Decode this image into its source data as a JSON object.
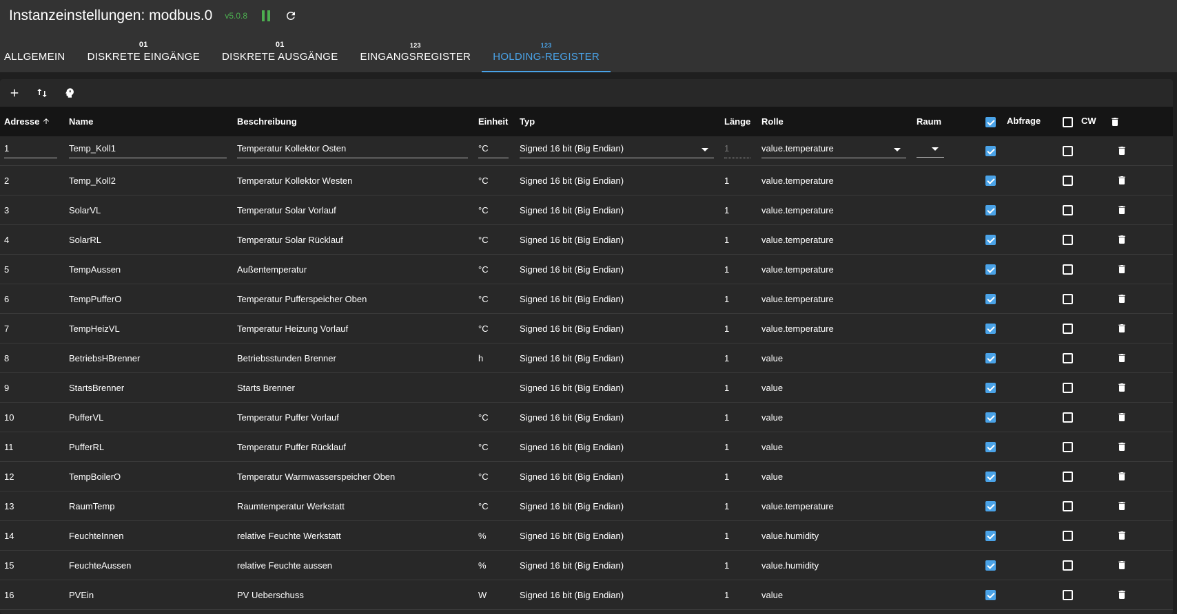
{
  "header": {
    "title": "Instanzeinstellungen: modbus.0",
    "version": "v5.0.8"
  },
  "tabs": [
    {
      "top": "",
      "label": "ALLGEMEIN",
      "active": false
    },
    {
      "top": "01",
      "label": "DISKRETE EINGÄNGE",
      "active": false
    },
    {
      "top": "01",
      "label": "DISKRETE AUSGÄNGE",
      "active": false
    },
    {
      "top": "123",
      "label": "EINGANGSREGISTER",
      "active": false
    },
    {
      "top": "123",
      "label": "HOLDING-REGISTER",
      "active": true
    }
  ],
  "columns": {
    "adresse": "Adresse",
    "name": "Name",
    "beschreibung": "Beschreibung",
    "einheit": "Einheit",
    "typ": "Typ",
    "laenge": "Länge",
    "rolle": "Rolle",
    "raum": "Raum",
    "abfrage": "Abfrage",
    "cw": "CW"
  },
  "icons": {
    "pause": "pause-icon",
    "reload": "reload-icon",
    "add": "plus-icon",
    "sort": "sort-arrows-icon",
    "ai": "head-icon",
    "delete": "trash-icon",
    "sort_asc": "arrow-up-icon"
  },
  "colors": {
    "accent": "#4aa3e8",
    "running": "#4caf50"
  },
  "rows": [
    {
      "adresse": "1",
      "name": "Temp_Koll1",
      "beschreibung": "Temperatur Kollektor Osten",
      "einheit": "°C",
      "typ": "Signed 16 bit (Big Endian)",
      "laenge": "1",
      "rolle": "value.temperature",
      "raum": "",
      "abfrage": true,
      "cw": false
    },
    {
      "adresse": "2",
      "name": "Temp_Koll2",
      "beschreibung": "Temperatur Kollektor Westen",
      "einheit": "°C",
      "typ": "Signed 16 bit (Big Endian)",
      "laenge": "1",
      "rolle": "value.temperature",
      "raum": "",
      "abfrage": true,
      "cw": false
    },
    {
      "adresse": "3",
      "name": "SolarVL",
      "beschreibung": "Temperatur Solar Vorlauf",
      "einheit": "°C",
      "typ": "Signed 16 bit (Big Endian)",
      "laenge": "1",
      "rolle": "value.temperature",
      "raum": "",
      "abfrage": true,
      "cw": false
    },
    {
      "adresse": "4",
      "name": "SolarRL",
      "beschreibung": "Temperatur Solar Rücklauf",
      "einheit": "°C",
      "typ": "Signed 16 bit (Big Endian)",
      "laenge": "1",
      "rolle": "value.temperature",
      "raum": "",
      "abfrage": true,
      "cw": false
    },
    {
      "adresse": "5",
      "name": "TempAussen",
      "beschreibung": "Außentemperatur",
      "einheit": "°C",
      "typ": "Signed 16 bit (Big Endian)",
      "laenge": "1",
      "rolle": "value.temperature",
      "raum": "",
      "abfrage": true,
      "cw": false
    },
    {
      "adresse": "6",
      "name": "TempPufferO",
      "beschreibung": "Temperatur Pufferspeicher Oben",
      "einheit": "°C",
      "typ": "Signed 16 bit (Big Endian)",
      "laenge": "1",
      "rolle": "value.temperature",
      "raum": "",
      "abfrage": true,
      "cw": false
    },
    {
      "adresse": "7",
      "name": "TempHeizVL",
      "beschreibung": "Temperatur Heizung Vorlauf",
      "einheit": "°C",
      "typ": "Signed 16 bit (Big Endian)",
      "laenge": "1",
      "rolle": "value.temperature",
      "raum": "",
      "abfrage": true,
      "cw": false
    },
    {
      "adresse": "8",
      "name": "BetriebsHBrenner",
      "beschreibung": "Betriebsstunden Brenner",
      "einheit": "h",
      "typ": "Signed 16 bit (Big Endian)",
      "laenge": "1",
      "rolle": "value",
      "raum": "",
      "abfrage": true,
      "cw": false
    },
    {
      "adresse": "9",
      "name": "StartsBrenner",
      "beschreibung": "Starts Brenner",
      "einheit": "",
      "typ": "Signed 16 bit (Big Endian)",
      "laenge": "1",
      "rolle": "value",
      "raum": "",
      "abfrage": true,
      "cw": false
    },
    {
      "adresse": "10",
      "name": "PufferVL",
      "beschreibung": "Temperatur Puffer Vorlauf",
      "einheit": "°C",
      "typ": "Signed 16 bit (Big Endian)",
      "laenge": "1",
      "rolle": "value",
      "raum": "",
      "abfrage": true,
      "cw": false
    },
    {
      "adresse": "11",
      "name": "PufferRL",
      "beschreibung": "Temperatur Puffer Rücklauf",
      "einheit": "°C",
      "typ": "Signed 16 bit (Big Endian)",
      "laenge": "1",
      "rolle": "value",
      "raum": "",
      "abfrage": true,
      "cw": false
    },
    {
      "adresse": "12",
      "name": "TempBoilerO",
      "beschreibung": "Temperatur Warmwasserspeicher Oben",
      "einheit": "°C",
      "typ": "Signed 16 bit (Big Endian)",
      "laenge": "1",
      "rolle": "value",
      "raum": "",
      "abfrage": true,
      "cw": false
    },
    {
      "adresse": "13",
      "name": "RaumTemp",
      "beschreibung": "Raumtemperatur Werkstatt",
      "einheit": "°C",
      "typ": "Signed 16 bit (Big Endian)",
      "laenge": "1",
      "rolle": "value.temperature",
      "raum": "",
      "abfrage": true,
      "cw": false
    },
    {
      "adresse": "14",
      "name": "FeuchteInnen",
      "beschreibung": "relative Feuchte Werkstatt",
      "einheit": "%",
      "typ": "Signed 16 bit (Big Endian)",
      "laenge": "1",
      "rolle": "value.humidity",
      "raum": "",
      "abfrage": true,
      "cw": false
    },
    {
      "adresse": "15",
      "name": "FeuchteAussen",
      "beschreibung": "relative Feuchte aussen",
      "einheit": "%",
      "typ": "Signed 16 bit (Big Endian)",
      "laenge": "1",
      "rolle": "value.humidity",
      "raum": "",
      "abfrage": true,
      "cw": false
    },
    {
      "adresse": "16",
      "name": "PVEin",
      "beschreibung": "PV Ueberschuss",
      "einheit": "W",
      "typ": "Signed 16 bit (Big Endian)",
      "laenge": "1",
      "rolle": "value",
      "raum": "",
      "abfrage": true,
      "cw": false
    }
  ]
}
